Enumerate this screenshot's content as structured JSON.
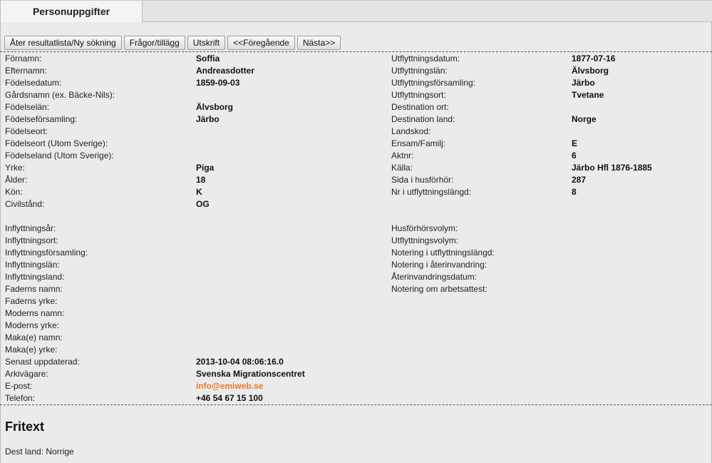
{
  "tab": {
    "label": "Personuppgifter"
  },
  "toolbar": {
    "buttons": [
      "Åter resultatlista/Ny sökning",
      "Frågor/tillägg",
      "Utskrift",
      "<<Föregående",
      "Nästa>>"
    ]
  },
  "left": [
    {
      "label": "Förnamn:",
      "value": "Soffia"
    },
    {
      "label": "Efternamn:",
      "value": "Andreasdotter"
    },
    {
      "label": "Födelsedatum:",
      "value": "1859-09-03"
    },
    {
      "label": "Gårdsnamn (ex. Bäcke-Nils):",
      "value": ""
    },
    {
      "label": "Födelselän:",
      "value": "Älvsborg"
    },
    {
      "label": "Födelseförsamling:",
      "value": "Järbo"
    },
    {
      "label": "Födelseort:",
      "value": ""
    },
    {
      "label": "Födelseort (Utom Sverige):",
      "value": ""
    },
    {
      "label": "Födelseland (Utom Sverige):",
      "value": ""
    },
    {
      "label": "Yrke:",
      "value": "Piga"
    },
    {
      "label": "Ålder:",
      "value": "18"
    },
    {
      "label": "Kön:",
      "value": "K"
    },
    {
      "label": "Civilstånd:",
      "value": "OG"
    },
    {
      "label": "",
      "value": ""
    },
    {
      "label": "Inflyttningsår:",
      "value": ""
    },
    {
      "label": "Inflyttningsort:",
      "value": ""
    },
    {
      "label": "Inflyttningsförsamling:",
      "value": ""
    },
    {
      "label": "Inflyttningslän:",
      "value": ""
    },
    {
      "label": "Inflyttningsland:",
      "value": ""
    },
    {
      "label": "Faderns namn:",
      "value": ""
    },
    {
      "label": "Faderns yrke:",
      "value": ""
    },
    {
      "label": "Moderns namn:",
      "value": ""
    },
    {
      "label": "Moderns yrke:",
      "value": ""
    },
    {
      "label": "Maka(e) namn:",
      "value": ""
    },
    {
      "label": "Maka(e) yrke:",
      "value": ""
    },
    {
      "label": "Senast uppdaterad:",
      "value": "2013-10-04 08:06:16.0"
    },
    {
      "label": "Arkivägare:",
      "value": "Svenska Migrationscentret"
    },
    {
      "label": "E-post:",
      "value": "info@emiweb.se"
    },
    {
      "label": "Telefon:",
      "value": "+46 54 67 15 100"
    }
  ],
  "right": [
    {
      "label": "Utflyttningsdatum:",
      "value": "1877-07-16"
    },
    {
      "label": "Utflyttningslän:",
      "value": "Älvsborg"
    },
    {
      "label": "Utflyttningsförsamling:",
      "value": "Järbo"
    },
    {
      "label": "Utflyttningsort:",
      "value": "Tvetane"
    },
    {
      "label": "Destination ort:",
      "value": ""
    },
    {
      "label": "Destination land:",
      "value": "Norge"
    },
    {
      "label": "Landskod:",
      "value": ""
    },
    {
      "label": "Ensam/Familj:",
      "value": "E"
    },
    {
      "label": "Aktnr:",
      "value": "6"
    },
    {
      "label": "Källa:",
      "value": "Järbo Hfl 1876-1885"
    },
    {
      "label": "Sida i husförhör:",
      "value": "287"
    },
    {
      "label": "Nr i utflyttningslängd:",
      "value": "8"
    },
    {
      "label": "",
      "value": ""
    },
    {
      "label": "",
      "value": ""
    },
    {
      "label": "Husförhörsvolym:",
      "value": ""
    },
    {
      "label": "Utflyttningsvolym:",
      "value": ""
    },
    {
      "label": "Notering i utflyttningslängd:",
      "value": ""
    },
    {
      "label": "Notering i återinvandring:",
      "value": ""
    },
    {
      "label": "Återinvandringsdatum:",
      "value": ""
    },
    {
      "label": "Notering om arbetsattest:",
      "value": ""
    }
  ],
  "fritext": {
    "title": "Fritext",
    "body": "Dest land: Norrige"
  },
  "colors": {
    "link": "#e87b2e",
    "background": "#ebebeb"
  }
}
